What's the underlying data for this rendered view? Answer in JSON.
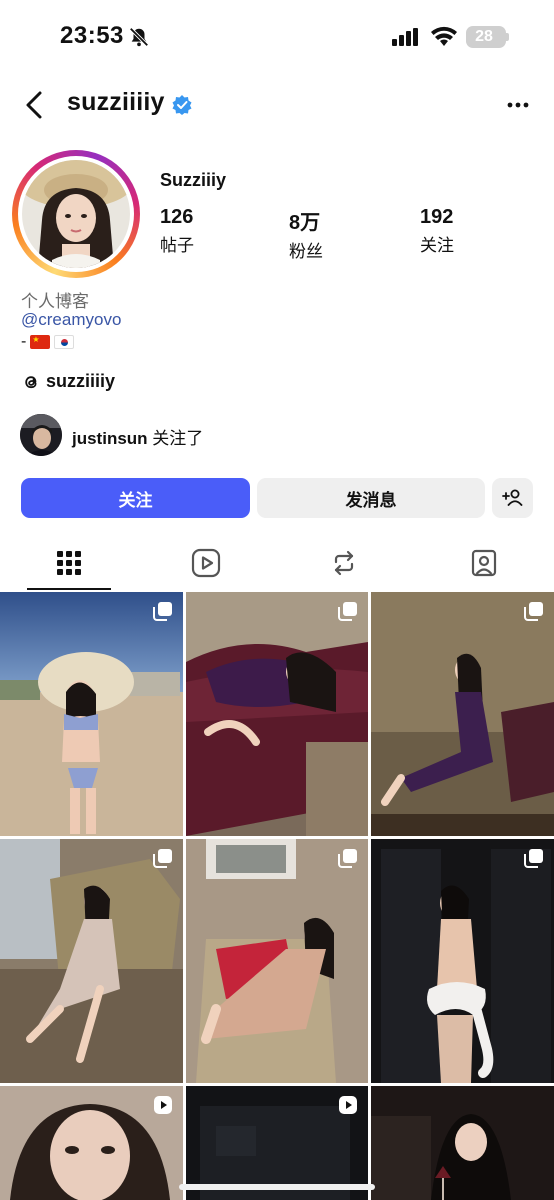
{
  "status_bar": {
    "time": "23:53",
    "battery": "28"
  },
  "header": {
    "username": "suzziiiiy",
    "verified": true
  },
  "profile": {
    "display_name": "Suzziiiy",
    "stats": [
      {
        "value": "126",
        "label": "帖子"
      },
      {
        "value": "8万",
        "label": "粉丝"
      },
      {
        "value": "192",
        "label": "关注"
      }
    ],
    "bio": {
      "category": "个人博客",
      "link": "@creamyovo",
      "dash": "-",
      "flags": [
        "china-flag",
        "south-korea-flag"
      ]
    },
    "threads_name": "suzziiiiy",
    "followed_by": {
      "name": "justinsun",
      "suffix": " 关注了"
    }
  },
  "actions": {
    "follow": "关注",
    "message": "发消息"
  },
  "tabs": [
    "grid-icon",
    "reels-icon",
    "reposts-icon",
    "tagged-icon"
  ],
  "grid": {
    "tiles": [
      {
        "badge": "carousel-icon"
      },
      {
        "badge": "carousel-icon"
      },
      {
        "badge": "carousel-icon"
      },
      {
        "badge": "carousel-icon"
      },
      {
        "badge": "carousel-icon"
      },
      {
        "badge": "carousel-icon"
      },
      {
        "badge": "reel-icon"
      },
      {
        "badge": "reel-icon"
      },
      {
        "badge": "none"
      }
    ]
  },
  "colors": {
    "primary_button": "#4a5df9",
    "secondary_button": "#efefef",
    "link": "#3a56a6",
    "verified": "#3897f0"
  }
}
